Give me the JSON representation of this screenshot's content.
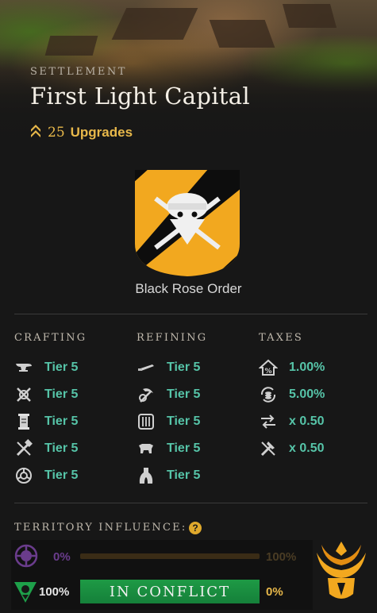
{
  "header": {
    "settlement_label": "SETTLEMENT",
    "title": "First Light Capital",
    "upgrades_count": "25",
    "upgrades_label": "Upgrades"
  },
  "company": {
    "name": "Black Rose Order",
    "shield_colors": [
      "#f2a81f",
      "#0d0d0d"
    ]
  },
  "crafting": {
    "heading": "CRAFTING",
    "items": [
      {
        "icon": "anvil-icon",
        "prefix": "Tier",
        "level": "5"
      },
      {
        "icon": "crossed-tools-icon",
        "prefix": "Tier",
        "level": "5"
      },
      {
        "icon": "scroll-icon",
        "prefix": "Tier",
        "level": "5"
      },
      {
        "icon": "hammer-saw-icon",
        "prefix": "Tier",
        "level": "5"
      },
      {
        "icon": "ring-icon",
        "prefix": "Tier",
        "level": "5"
      }
    ]
  },
  "refining": {
    "heading": "REFINING",
    "items": [
      {
        "icon": "blade-icon",
        "prefix": "Tier",
        "level": "5"
      },
      {
        "icon": "pickaxe-icon",
        "prefix": "Tier",
        "level": "5"
      },
      {
        "icon": "loom-icon",
        "prefix": "Tier",
        "level": "5"
      },
      {
        "icon": "tanning-rack-icon",
        "prefix": "Tier",
        "level": "5"
      },
      {
        "icon": "kiln-icon",
        "prefix": "Tier",
        "level": "5"
      }
    ]
  },
  "taxes": {
    "heading": "TAXES",
    "items": [
      {
        "icon": "property-tax-icon",
        "value": "1.00%"
      },
      {
        "icon": "coin-cycle-icon",
        "value": "5.00%"
      },
      {
        "icon": "trade-arrows-icon",
        "value": "x 0.50"
      },
      {
        "icon": "crafting-fee-icon",
        "value": "x 0.50"
      }
    ]
  },
  "influence": {
    "label": "TERRITORY INFLUENCE:",
    "help": "?",
    "row1_left": "0%",
    "row1_right": "100%",
    "row2_left": "100%",
    "row2_status": "IN CONFLICT",
    "row2_right": "0%",
    "colors": {
      "syndicate": "#6a3c8c",
      "marauders": "#1ea04a",
      "covenant": "#f2a81f"
    }
  }
}
